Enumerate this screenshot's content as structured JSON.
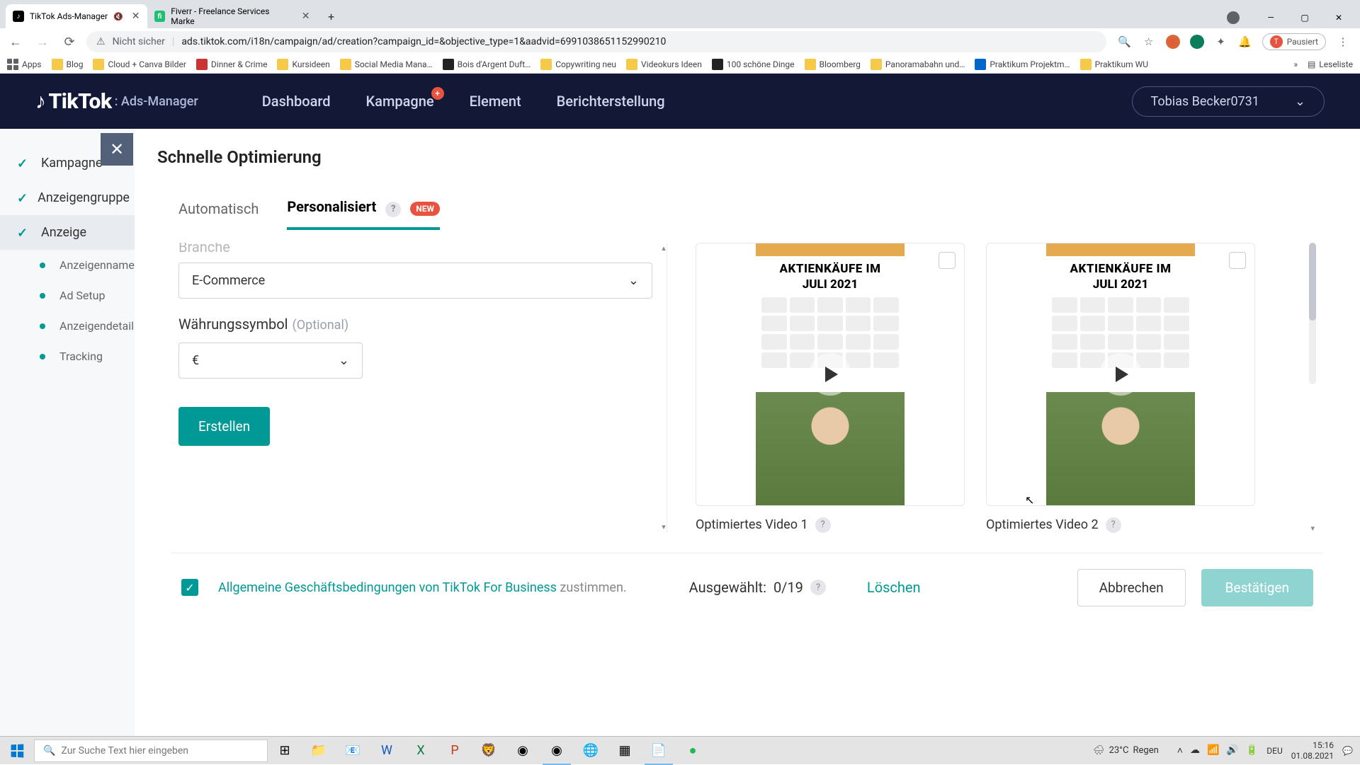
{
  "browser": {
    "tabs": [
      {
        "title": "TikTok Ads-Manager",
        "active": true,
        "muted": true
      },
      {
        "title": "Fiverr - Freelance Services Marke",
        "active": false
      }
    ],
    "url": "ads.tiktok.com/i18n/campaign/ad/creation?campaign_id=&objective_type=1&aadvid=6991038651152990210",
    "security": "Nicht sicher",
    "paused": "Pausiert",
    "bookmarks": [
      "Apps",
      "Blog",
      "Cloud + Canva Bilder",
      "Dinner & Crime",
      "Kursideen",
      "Social Media Mana…",
      "Bois d'Argent Duft…",
      "Copywriting neu",
      "Videokurs Ideen",
      "100 schöne Dinge",
      "Bloomberg",
      "Panoramabahn und…",
      "Praktikum Projektm…",
      "Praktikum WU"
    ],
    "reading_list": "Leseliste"
  },
  "tt": {
    "brand": "TikTok",
    "brand_sub": ": Ads-Manager",
    "nav": [
      "Dashboard",
      "Kampagne",
      "Element",
      "Berichterstellung"
    ],
    "user": "Tobias Becker0731"
  },
  "sidebar": {
    "top": [
      "Kampagne",
      "Anzeigengruppe",
      "Anzeige"
    ],
    "sub": [
      "Anzeigenname",
      "Ad Setup",
      "Anzeigendetails",
      "Tracking"
    ]
  },
  "modal": {
    "title": "Schnelle Optimierung",
    "tabs": {
      "auto": "Automatisch",
      "pers": "Personalisiert",
      "new": "NEW"
    },
    "branche_label": "Branche",
    "branche_value": "E-Commerce",
    "currency_label": "Währungssymbol",
    "currency_optional": "(Optional)",
    "currency_value": "€",
    "create": "Erstellen",
    "videos": [
      {
        "title": "Optimiertes Video 1",
        "headline1": "AKTIENKÄUFE IM",
        "headline2": "JULI 2021"
      },
      {
        "title": "Optimiertes Video 2",
        "headline1": "AKTIENKÄUFE IM",
        "headline2": "JULI 2021"
      }
    ],
    "terms_link": "Allgemeine Geschäftsbedingungen von TikTok For Business",
    "terms_suffix": " zustimmen.",
    "selected_label": "Ausgewählt:",
    "selected_count": "0/19",
    "delete": "Löschen",
    "cancel": "Abbrechen",
    "confirm": "Bestätigen"
  },
  "taskbar": {
    "search_placeholder": "Zur Suche Text hier eingeben",
    "weather_temp": "23°C",
    "weather_text": "Regen",
    "time": "15:16",
    "date": "01.08.2021",
    "lang": "DEU"
  }
}
